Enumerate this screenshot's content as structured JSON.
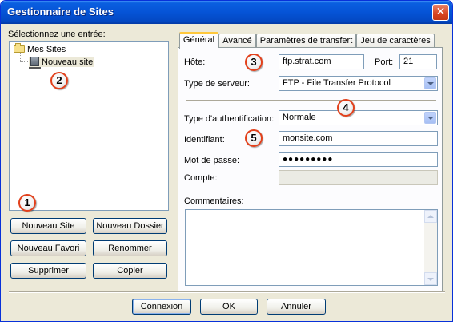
{
  "window": {
    "title": "Gestionnaire de Sites",
    "close_glyph": "✕"
  },
  "sites": {
    "prompt": "Sélectionnez une entrée:",
    "tree": [
      {
        "label": "Mes Sites",
        "icon": "folder-icon"
      },
      {
        "label": "Nouveau site",
        "icon": "server-icon",
        "selected": true
      }
    ]
  },
  "site_buttons": {
    "new_site": "Nouveau Site",
    "new_folder": "Nouveau Dossier",
    "new_bookmark": "Nouveau Favori",
    "rename": "Renommer",
    "delete": "Supprimer",
    "copy": "Copier"
  },
  "tabs": [
    "Général",
    "Avancé",
    "Paramètres de transfert",
    "Jeu de caractères"
  ],
  "general": {
    "host_label": "Hôte:",
    "host_value": "ftp.strat.com",
    "port_label": "Port:",
    "port_value": "21",
    "server_type_label": "Type de serveur:",
    "server_type_value": "FTP - File Transfer Protocol",
    "auth_type_label": "Type d'authentification:",
    "auth_type_value": "Normale",
    "user_label": "Identifiant:",
    "user_value": "monsite.com",
    "password_label": "Mot de passe:",
    "password_value": "●●●●●●●●●",
    "account_label": "Compte:",
    "account_value": "",
    "comments_label": "Commentaires:",
    "comments_value": ""
  },
  "dialog_buttons": {
    "connect": "Connexion",
    "ok": "OK",
    "cancel": "Annuler"
  },
  "annotations": [
    "1",
    "2",
    "3",
    "4",
    "5"
  ],
  "colors": {
    "titlebar": "#0553d6",
    "annotation_ring": "#e2401b",
    "dialog_bg": "#ece9d8"
  }
}
